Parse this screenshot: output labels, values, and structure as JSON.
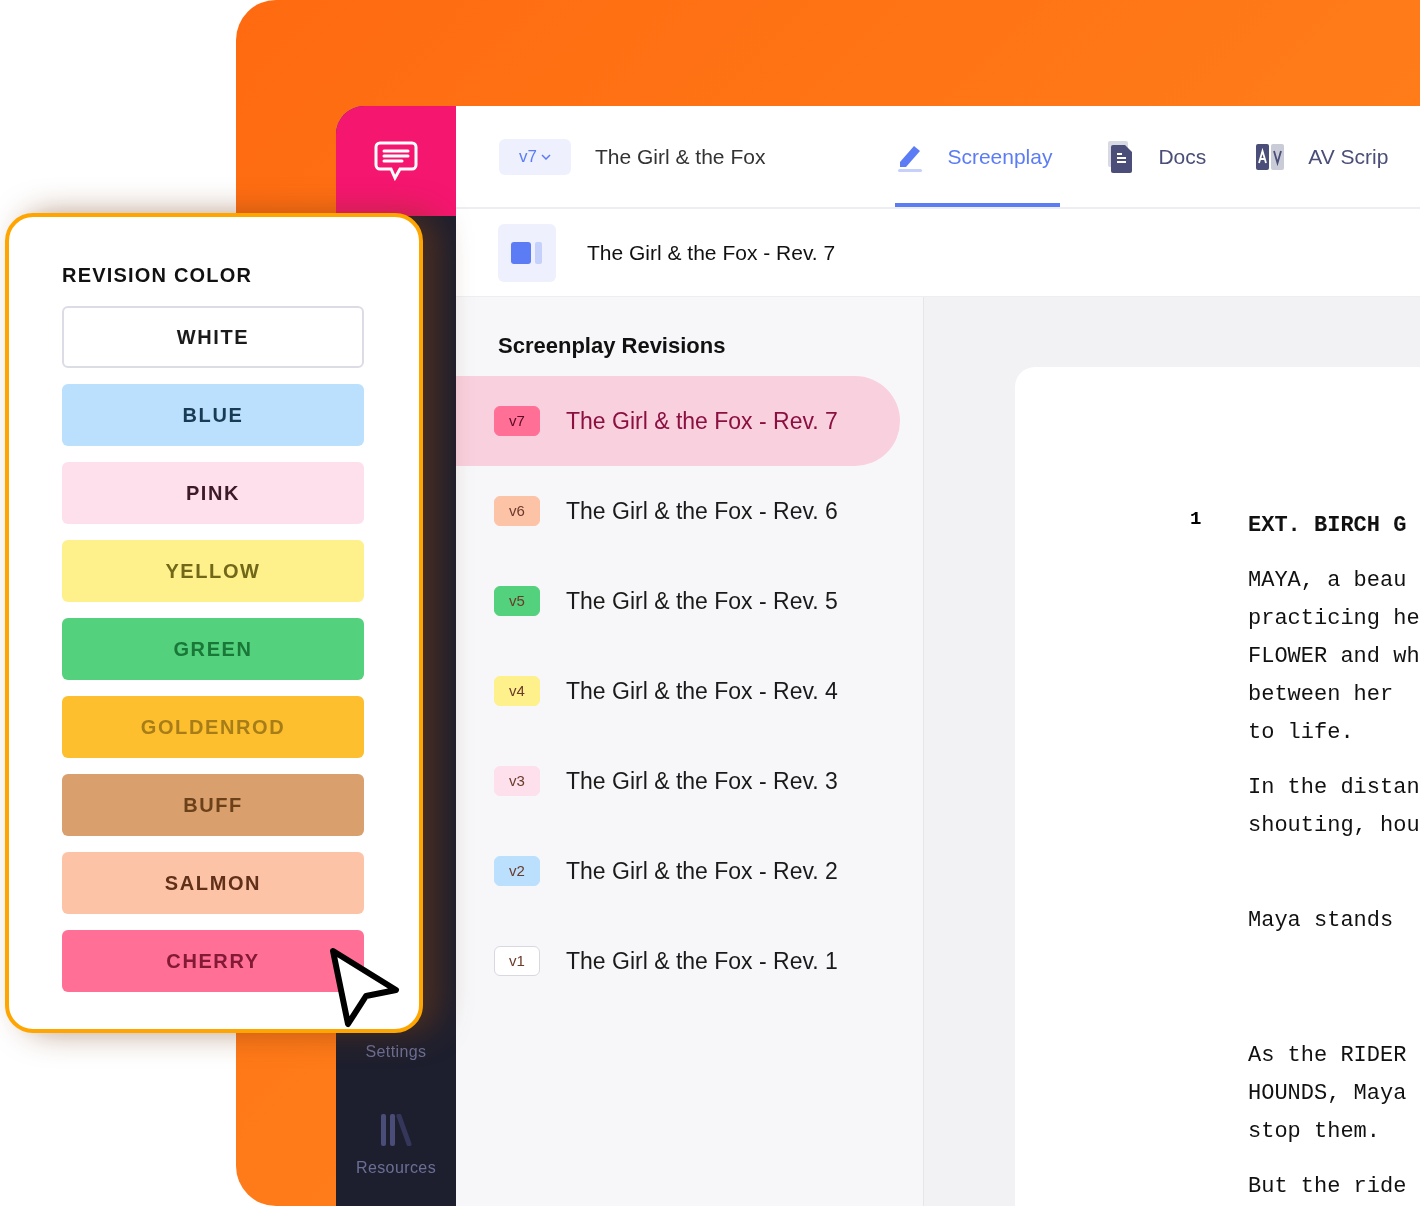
{
  "sidebar": {
    "items": [
      {
        "label": "Settings",
        "kind": "settings"
      },
      {
        "label": "Resources",
        "kind": "resources"
      }
    ]
  },
  "header": {
    "version": "v7",
    "project_title": "The Girl & the Fox",
    "tabs": [
      {
        "label": "Screenplay",
        "kind": "screenplay",
        "selected": true
      },
      {
        "label": "Docs",
        "kind": "docs",
        "selected": false
      },
      {
        "label": "AV Scrip",
        "kind": "av",
        "selected": false
      }
    ]
  },
  "document_bar": {
    "title": "The Girl & the Fox - Rev. 7"
  },
  "revisions": {
    "heading": "Screenplay Revisions",
    "items": [
      {
        "badge": "v7",
        "title": "The Girl & the Fox - Rev. 7",
        "color": "#ff6f96",
        "selected": true
      },
      {
        "badge": "v6",
        "title": "The Girl & the Fox - Rev. 6",
        "color": "#fdc3a7",
        "selected": false
      },
      {
        "badge": "v5",
        "title": "The Girl & the Fox - Rev. 5",
        "color": "#53d17c",
        "selected": false
      },
      {
        "badge": "v4",
        "title": "The Girl & the Fox - Rev. 4",
        "color": "#fef08a",
        "selected": false
      },
      {
        "badge": "v3",
        "title": "The Girl & the Fox - Rev. 3",
        "color": "#fde0ec",
        "selected": false
      },
      {
        "badge": "v2",
        "title": "The Girl & the Fox - Rev. 2",
        "color": "#bae0fd",
        "selected": false
      },
      {
        "badge": "v1",
        "title": "The Girl & the Fox - Rev. 1",
        "color": "#ffffff",
        "selected": false
      }
    ]
  },
  "script_page": {
    "scene_number": "1",
    "blocks": [
      {
        "kind": "heading",
        "lines": [
          "EXT. BIRCH G"
        ]
      },
      {
        "kind": "action",
        "lines": [
          "MAYA, a beau",
          "practicing he",
          "FLOWER and wh",
          "between her",
          "to life."
        ]
      },
      {
        "kind": "action",
        "lines": [
          "In the distan",
          "shouting, hou"
        ]
      },
      {
        "kind": "action",
        "lines": [
          "Maya stands"
        ]
      },
      {
        "kind": "action",
        "lines": [
          "As the RIDER",
          "HOUNDS, Maya",
          "stop them."
        ]
      },
      {
        "kind": "action",
        "lines": [
          "But the ride"
        ]
      }
    ]
  },
  "revision_color_popup": {
    "heading": "REVISION COLOR",
    "options": [
      {
        "label": "WHITE",
        "color": "#ffffff"
      },
      {
        "label": "BLUE",
        "color": "#bae0fd"
      },
      {
        "label": "PINK",
        "color": "#fde0ec"
      },
      {
        "label": "YELLOW",
        "color": "#fef08a"
      },
      {
        "label": "GREEN",
        "color": "#53d17c"
      },
      {
        "label": "GOLDENROD",
        "color": "#fdbf2d"
      },
      {
        "label": "BUFF",
        "color": "#d9a06e"
      },
      {
        "label": "SALMON",
        "color": "#fdc3a7"
      },
      {
        "label": "CHERRY",
        "color": "#ff6f96"
      }
    ]
  }
}
